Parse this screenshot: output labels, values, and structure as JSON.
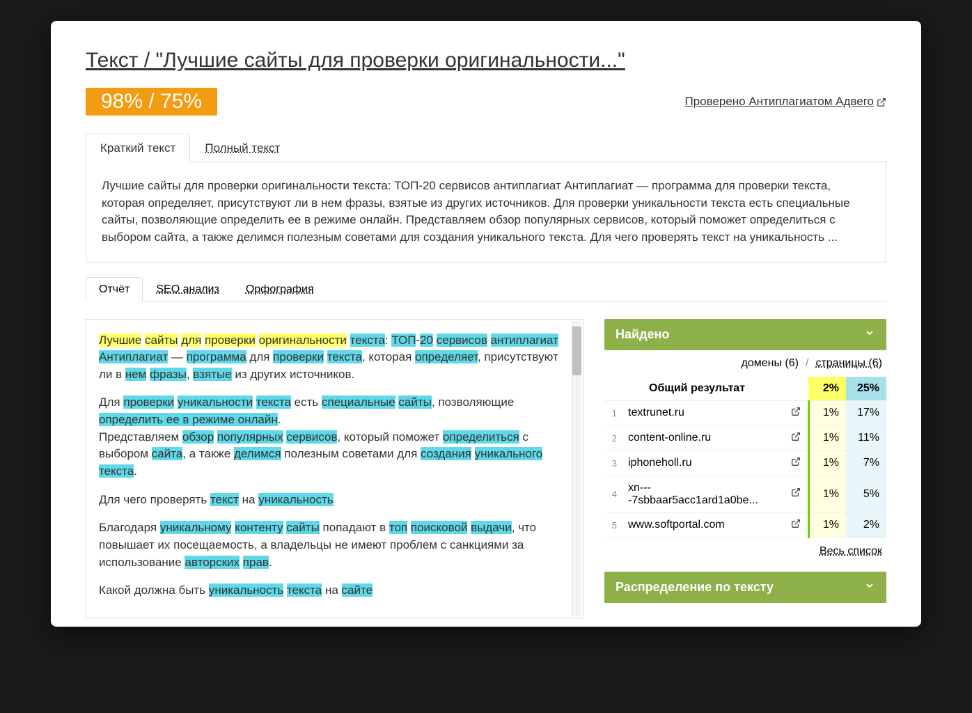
{
  "title": "Текст / \"Лучшие сайты для проверки оригинальности...\"",
  "score": "98% / 75%",
  "verified_by": "Проверено Антиплагиатом Адвего",
  "text_tabs": {
    "short": "Краткий текст",
    "full": "Полный текст"
  },
  "summary": "Лучшие сайты для проверки оригинальности текста: ТОП-20 сервисов антиплагиат Антиплагиат — программа для проверки текста, которая определяет, присутствуют ли в нем фразы, взятые из других источников. Для проверки уникальности текста есть специальные сайты, позволяющие определить ее в режиме онлайн. Представляем обзор популярных сервисов, который поможет определиться с выбором сайта, а также делимся полезным советами для создания уникального текста. Для чего проверять текст на уникальность ...",
  "report_tabs": {
    "report": "Отчёт",
    "seo": "SEO анализ",
    "spelling": "Орфография"
  },
  "found_header": "Найдено",
  "side_tabs": {
    "domains": "домены (6)",
    "pages": "страницы (6)"
  },
  "overall_label": "Общий результат",
  "overall_p1": "2%",
  "overall_p2": "25%",
  "rows": [
    {
      "n": "1",
      "domain": "textrunet.ru",
      "p1": "1%",
      "p2": "17%"
    },
    {
      "n": "2",
      "domain": "content-online.ru",
      "p1": "1%",
      "p2": "11%"
    },
    {
      "n": "3",
      "domain": "iphoneholl.ru",
      "p1": "1%",
      "p2": "7%"
    },
    {
      "n": "4",
      "domain": "xn----7sbbaar5acc1ard1a0be...",
      "p1": "1%",
      "p2": "5%"
    },
    {
      "n": "5",
      "domain": "www.softportal.com",
      "p1": "1%",
      "p2": "2%"
    }
  ],
  "full_list": "Весь список",
  "dist_header": "Распределение по тексту",
  "rt": {
    "p1_a": "Лучшие",
    "p1_b": "сайты",
    "p1_c": "для",
    "p1_d": "проверки",
    "p1_e": "оригинальности",
    "p1_f": "текста",
    "p1_g": "ТОП",
    "p1_h": "20",
    "p1_i": "сервисов",
    "p1_j": "антиплагиат",
    "p2_a": "Антиплагиат",
    "p2_b": "программа",
    "p2_c": "проверки",
    "p2_d": "текста",
    "p2_e": "определяет",
    "p2_f": "нем",
    "p2_g": "фразы",
    "p2_h": "взятые",
    "p3_a": "проверки",
    "p3_b": "уникальности",
    "p3_c": "текста",
    "p3_d": "специальные",
    "p3_e": "сайты",
    "p3_f": "определить ее в режиме онлайн",
    "p4_a": "обзор",
    "p4_b": "популярных",
    "p4_c": "сервисов",
    "p4_d": "определиться",
    "p4_e": "сайта",
    "p4_f": "делимся",
    "p5_a": "создания",
    "p5_b": "уникального",
    "p5_c": "текста",
    "p6_a": "текст",
    "p6_b": "уникальность",
    "p7_a": "уникальному",
    "p7_b": "контенту",
    "p7_c": "сайты",
    "p7_d": "топ",
    "p7_e": "поисковой",
    "p7_f": "выдачи",
    "p8_a": "авторских",
    "p8_b": "прав",
    "p9_a": "уникальность",
    "p9_b": "текста",
    "p9_c": "сайте"
  }
}
